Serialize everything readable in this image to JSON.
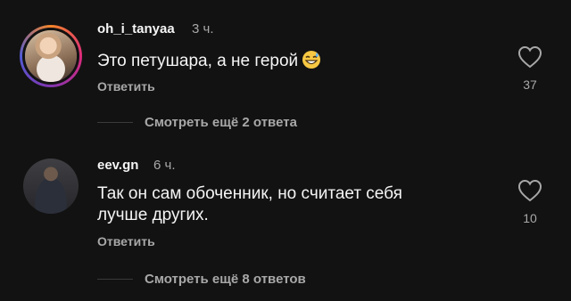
{
  "comments": [
    {
      "username": "oh_i_tanyaa",
      "time": "3 ч.",
      "text": "Это петушара, а не герой",
      "emoji": "grinning-sweat-emoji",
      "reply_label": "Ответить",
      "likes": "37",
      "more_replies": "Смотреть ещё 2 ответа"
    },
    {
      "username": "eev.gn",
      "time": "6 ч.",
      "text_line1": "Так он сам обоченник, но считает себя",
      "text_line2": "лучше других.",
      "reply_label": "Ответить",
      "likes": "10",
      "more_replies": "Смотреть ещё 8 ответов"
    }
  ],
  "colors": {
    "background": "#121212",
    "primary_text": "#f5f5f5",
    "secondary_text": "#a8a8a8"
  }
}
